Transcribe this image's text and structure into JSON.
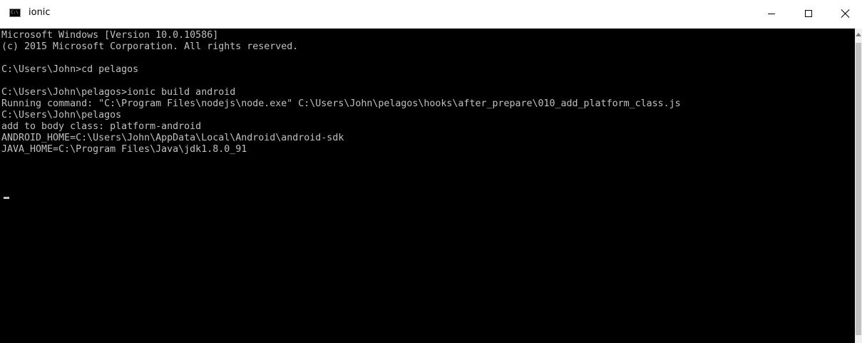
{
  "window": {
    "title": "ionic",
    "icon": "console-app-icon",
    "controls": {
      "minimize": "minimize-icon",
      "maximize": "maximize-icon",
      "close": "close-icon"
    }
  },
  "console": {
    "lines": [
      "Microsoft Windows [Version 10.0.10586]",
      "(c) 2015 Microsoft Corporation. All rights reserved.",
      "",
      "C:\\Users\\John>cd pelagos",
      "",
      "C:\\Users\\John\\pelagos>ionic build android",
      "Running command: \"C:\\Program Files\\nodejs\\node.exe\" C:\\Users\\John\\pelagos\\hooks\\after_prepare\\010_add_platform_class.js",
      "C:\\Users\\John\\pelagos",
      "add to body class: platform-android",
      "ANDROID_HOME=C:\\Users\\John\\AppData\\Local\\Android\\android-sdk",
      "JAVA_HOME=C:\\Program Files\\Java\\jdk1.8.0_91"
    ]
  },
  "colors": {
    "console_background": "#000000",
    "console_text": "#c0c0c0",
    "titlebar_background": "#ffffff"
  }
}
